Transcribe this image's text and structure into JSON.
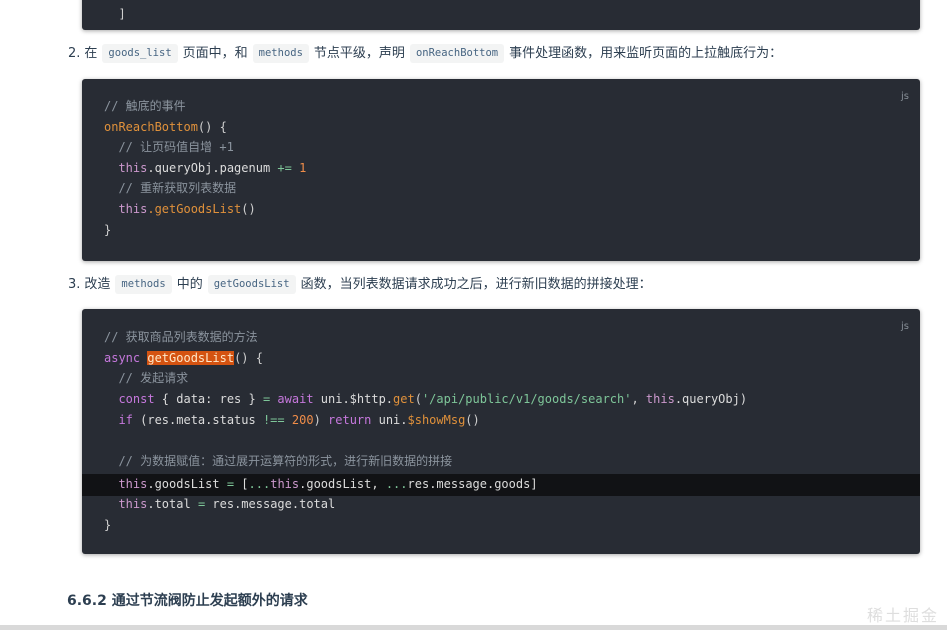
{
  "top_block": {
    "last_line": "  ]"
  },
  "step2": {
    "num": "2.",
    "t1": "在",
    "c1": "goods_list",
    "t2": "页面中，和",
    "c2": "methods",
    "t3": "节点平级，声明",
    "c3": "onReachBottom",
    "t4": "事件处理函数，用来监听页面的上拉触底行为："
  },
  "block2": {
    "lang": "js",
    "l1": "// 触底的事件",
    "l2_fn": "onReachBottom",
    "l2_rest": "() {",
    "l3": "  // 让页码值自增 +1",
    "l4_this": "this",
    "l4_mid": ".queryObj.pagenum ",
    "l4_op": "+=",
    "l4_num": "1",
    "l5": "  // 重新获取列表数据",
    "l6_this": "this",
    "l6_fn": ".getGoodsList",
    "l6_rest": "()",
    "l7": "}"
  },
  "step3": {
    "num": "3.",
    "t1": "改造",
    "c1": "methods",
    "t2": "中的",
    "c2": "getGoodsList",
    "t3": "函数，当列表数据请求成功之后，进行新旧数据的拼接处理："
  },
  "block3": {
    "lang": "js",
    "l1": "// 获取商品列表数据的方法",
    "l2_kw": "async",
    "l2_fn": "getGoodsList",
    "l2_rest": "() {",
    "l3": "  // 发起请求",
    "l4_kw": "const",
    "l4_a": " { data: res } ",
    "l4_op": "=",
    "l4_kw2": "await",
    "l4_b": " uni.$http.",
    "l4_fn": "get",
    "l4_c": "(",
    "l4_str": "'/api/public/v1/goods/search'",
    "l4_d": ", ",
    "l4_this": "this",
    "l4_e": ".queryObj)",
    "l5_kw": "if",
    "l5_a": " (res.meta.status ",
    "l5_op": "!==",
    "l5_num": "200",
    "l5_b": ") ",
    "l5_kw2": "return",
    "l5_c": " uni.",
    "l5_fn": "$showMsg",
    "l5_d": "()",
    "l7": "  // 为数据赋值：通过展开运算符的形式，进行新旧数据的拼接",
    "l8_this": "this",
    "l8_a": ".goodsList ",
    "l8_op": "=",
    "l8_b": " [",
    "l8_op2": "...",
    "l8_this2": "this",
    "l8_c": ".goodsList, ",
    "l8_op3": "...",
    "l8_d": "res.message.goods]",
    "l9_this": "this",
    "l9_a": ".total ",
    "l9_op": "=",
    "l9_b": " res.message.total",
    "l10": "}"
  },
  "heading": "6.6.2 通过节流阀防止发起额外的请求",
  "watermark": "稀土掘金"
}
